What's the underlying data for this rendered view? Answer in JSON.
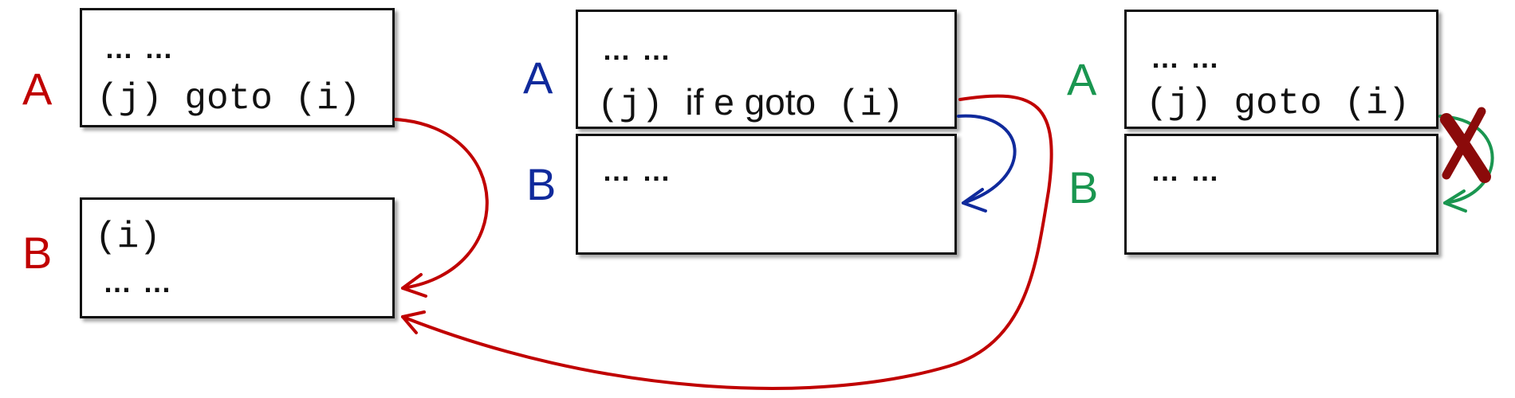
{
  "colors": {
    "red": "#c00000",
    "blue": "#102a9c",
    "green": "#1a9650",
    "cross": "#8b0a0a"
  },
  "panels": [
    {
      "a_label": "A",
      "b_label": "B",
      "a_dots": "… …",
      "a_code": "(j) goto (i)",
      "b_code": "(i)",
      "b_dots": "… …"
    },
    {
      "a_label": "A",
      "b_label": "B",
      "a_dots": "… …",
      "a_code_prefix": "(j) ",
      "a_code_keyword": "if e goto",
      "a_code_suffix": " (i)",
      "b_dots": "… …"
    },
    {
      "a_label": "A",
      "b_label": "B",
      "a_dots": "… …",
      "a_code": "(j) goto (i)",
      "b_dots": "… …"
    }
  ],
  "icons": {
    "cross": "cross-mark-icon"
  }
}
